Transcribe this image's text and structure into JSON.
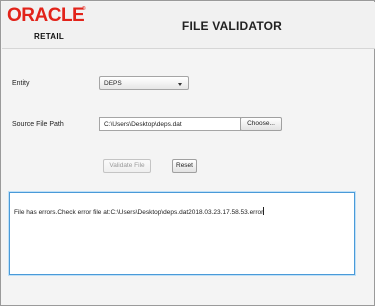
{
  "header": {
    "logo": {
      "brand": "ORACLE",
      "registered": "®",
      "product": "RETAIL"
    },
    "title": "FILE VALIDATOR"
  },
  "form": {
    "entity": {
      "label": "Entity",
      "selected": "DEPS"
    },
    "source_file": {
      "label": "Source File Path",
      "value": "C:\\Users\\Desktop\\deps.dat",
      "choose_label": "Choose..."
    },
    "actions": {
      "validate_label": "Validate File",
      "reset_label": "Reset"
    }
  },
  "output": {
    "text": "File  has errors.Check error file at:C:\\Users\\Desktop\\deps.dat2018.03.23.17.58.53.error"
  }
}
